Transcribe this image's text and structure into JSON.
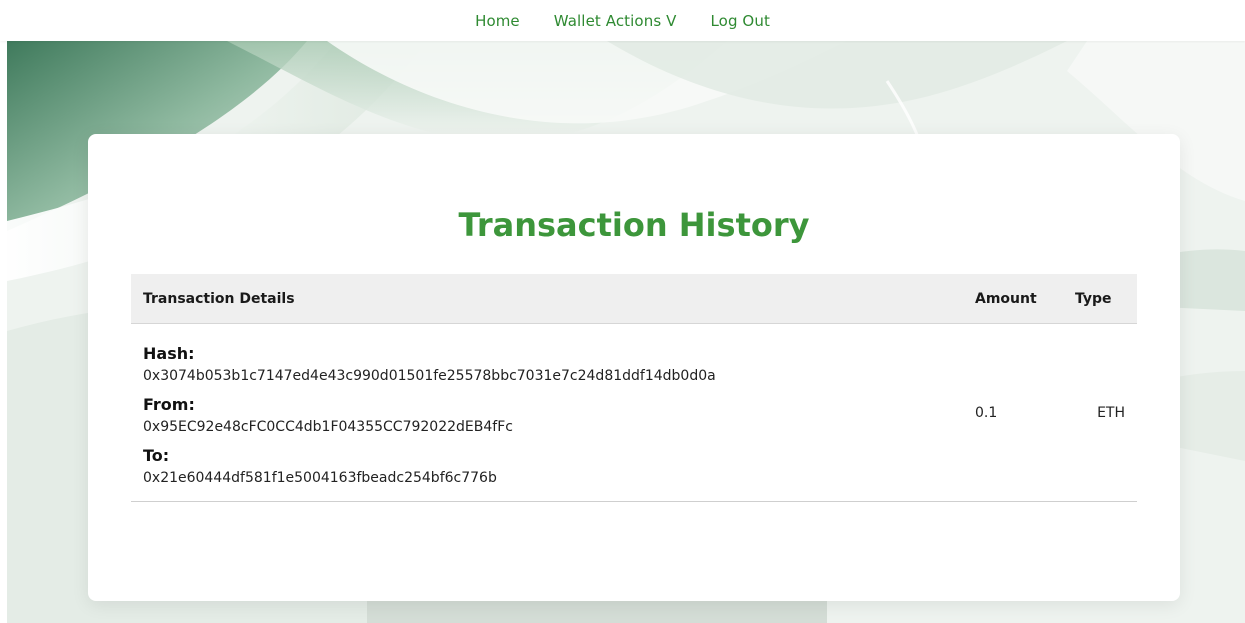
{
  "nav": {
    "items": [
      {
        "label": "Home"
      },
      {
        "label": "Wallet Actions V"
      },
      {
        "label": "Log Out"
      }
    ]
  },
  "page": {
    "title": "Transaction History"
  },
  "table": {
    "headers": {
      "details": "Transaction Details",
      "amount": "Amount",
      "type": "Type"
    },
    "rows": [
      {
        "hash_label": "Hash:",
        "hash": "0x3074b053b1c7147ed4e43c990d01501fe25578bbc7031e7c24d81ddf14db0d0a",
        "from_label": "From:",
        "from": "0x95EC92e48cFC0CC4db1F04355CC792022dEB4fFc",
        "to_label": "To:",
        "to": "0x21e60444df581f1e5004163fbeadc254bf6c776b",
        "amount": "0.1",
        "type": "ETH"
      }
    ]
  },
  "colors": {
    "brand_green": "#3d963b",
    "nav_green": "#2f8a32"
  }
}
